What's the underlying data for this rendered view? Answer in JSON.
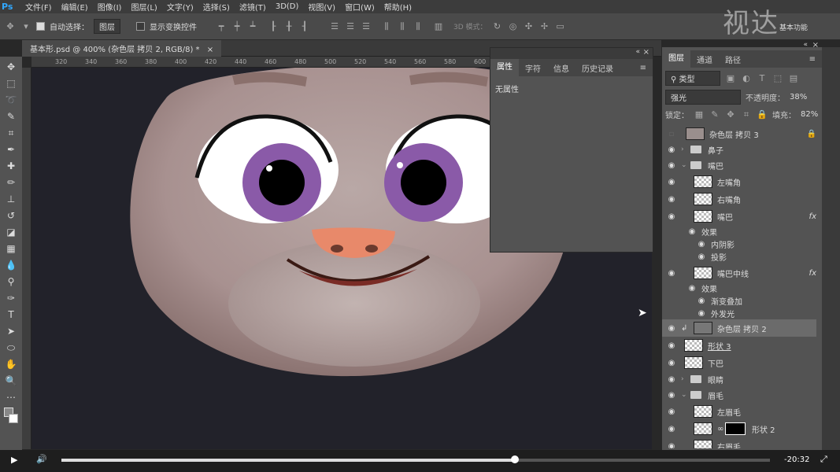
{
  "menu": {
    "logo": "Ps",
    "items": [
      "文件(F)",
      "编辑(E)",
      "图像(I)",
      "图层(L)",
      "文字(Y)",
      "选择(S)",
      "滤镜(T)",
      "3D(D)",
      "视图(V)",
      "窗口(W)",
      "帮助(H)"
    ]
  },
  "options": {
    "auto_select_label": "自动选择：",
    "auto_select_value": "图层",
    "show_transform_label": "显示变换控件",
    "mode_3d_label": "3D 模式：",
    "workspace": "基本功能"
  },
  "watermark": "视达",
  "doc_tab": "基本形.psd @ 400% (杂色层 拷贝 2, RGB/8) *",
  "ruler_h": [
    "320",
    "340",
    "360",
    "380",
    "400",
    "420",
    "440",
    "460",
    "480",
    "500",
    "520",
    "540",
    "560",
    "580",
    "600"
  ],
  "properties": {
    "tabs": [
      "属性",
      "字符",
      "信息",
      "历史记录"
    ],
    "body": "无属性"
  },
  "layers_panel": {
    "tabs": [
      "图层",
      "通道",
      "路径"
    ],
    "filter": "类型",
    "blend": "强光",
    "opacity_label": "不透明度：",
    "opacity": "38%",
    "lock_label": "锁定：",
    "fill_label": "填充：",
    "fill": "82%",
    "rows": [
      {
        "name": "杂色层 拷贝 3",
        "type": "layer"
      },
      {
        "name": "鼻子",
        "type": "folder"
      },
      {
        "name": "嘴巴",
        "type": "folder"
      },
      {
        "name": "左嘴角",
        "type": "layer"
      },
      {
        "name": "右嘴角",
        "type": "layer"
      },
      {
        "name": "嘴巴",
        "type": "layer",
        "fx": "fx"
      },
      {
        "name": "效果",
        "type": "sub"
      },
      {
        "name": "内阴影",
        "type": "sub2"
      },
      {
        "name": "投影",
        "type": "sub2"
      },
      {
        "name": "嘴巴中线",
        "type": "layer",
        "fx": "fx"
      },
      {
        "name": "效果",
        "type": "sub"
      },
      {
        "name": "渐变叠加",
        "type": "sub2"
      },
      {
        "name": "外发光",
        "type": "sub2"
      },
      {
        "name": "杂色层 拷贝 2",
        "type": "layer",
        "selected": true
      },
      {
        "name": "形状 3",
        "type": "layer"
      },
      {
        "name": "下巴",
        "type": "layer"
      },
      {
        "name": "眼睛",
        "type": "folder"
      },
      {
        "name": "眉毛",
        "type": "folder"
      },
      {
        "name": "左眉毛",
        "type": "layer"
      },
      {
        "name": "形状 2",
        "type": "layer"
      },
      {
        "name": "右眉毛",
        "type": "layer"
      }
    ]
  },
  "video": {
    "time": "-20:32",
    "progress": 0.64
  }
}
